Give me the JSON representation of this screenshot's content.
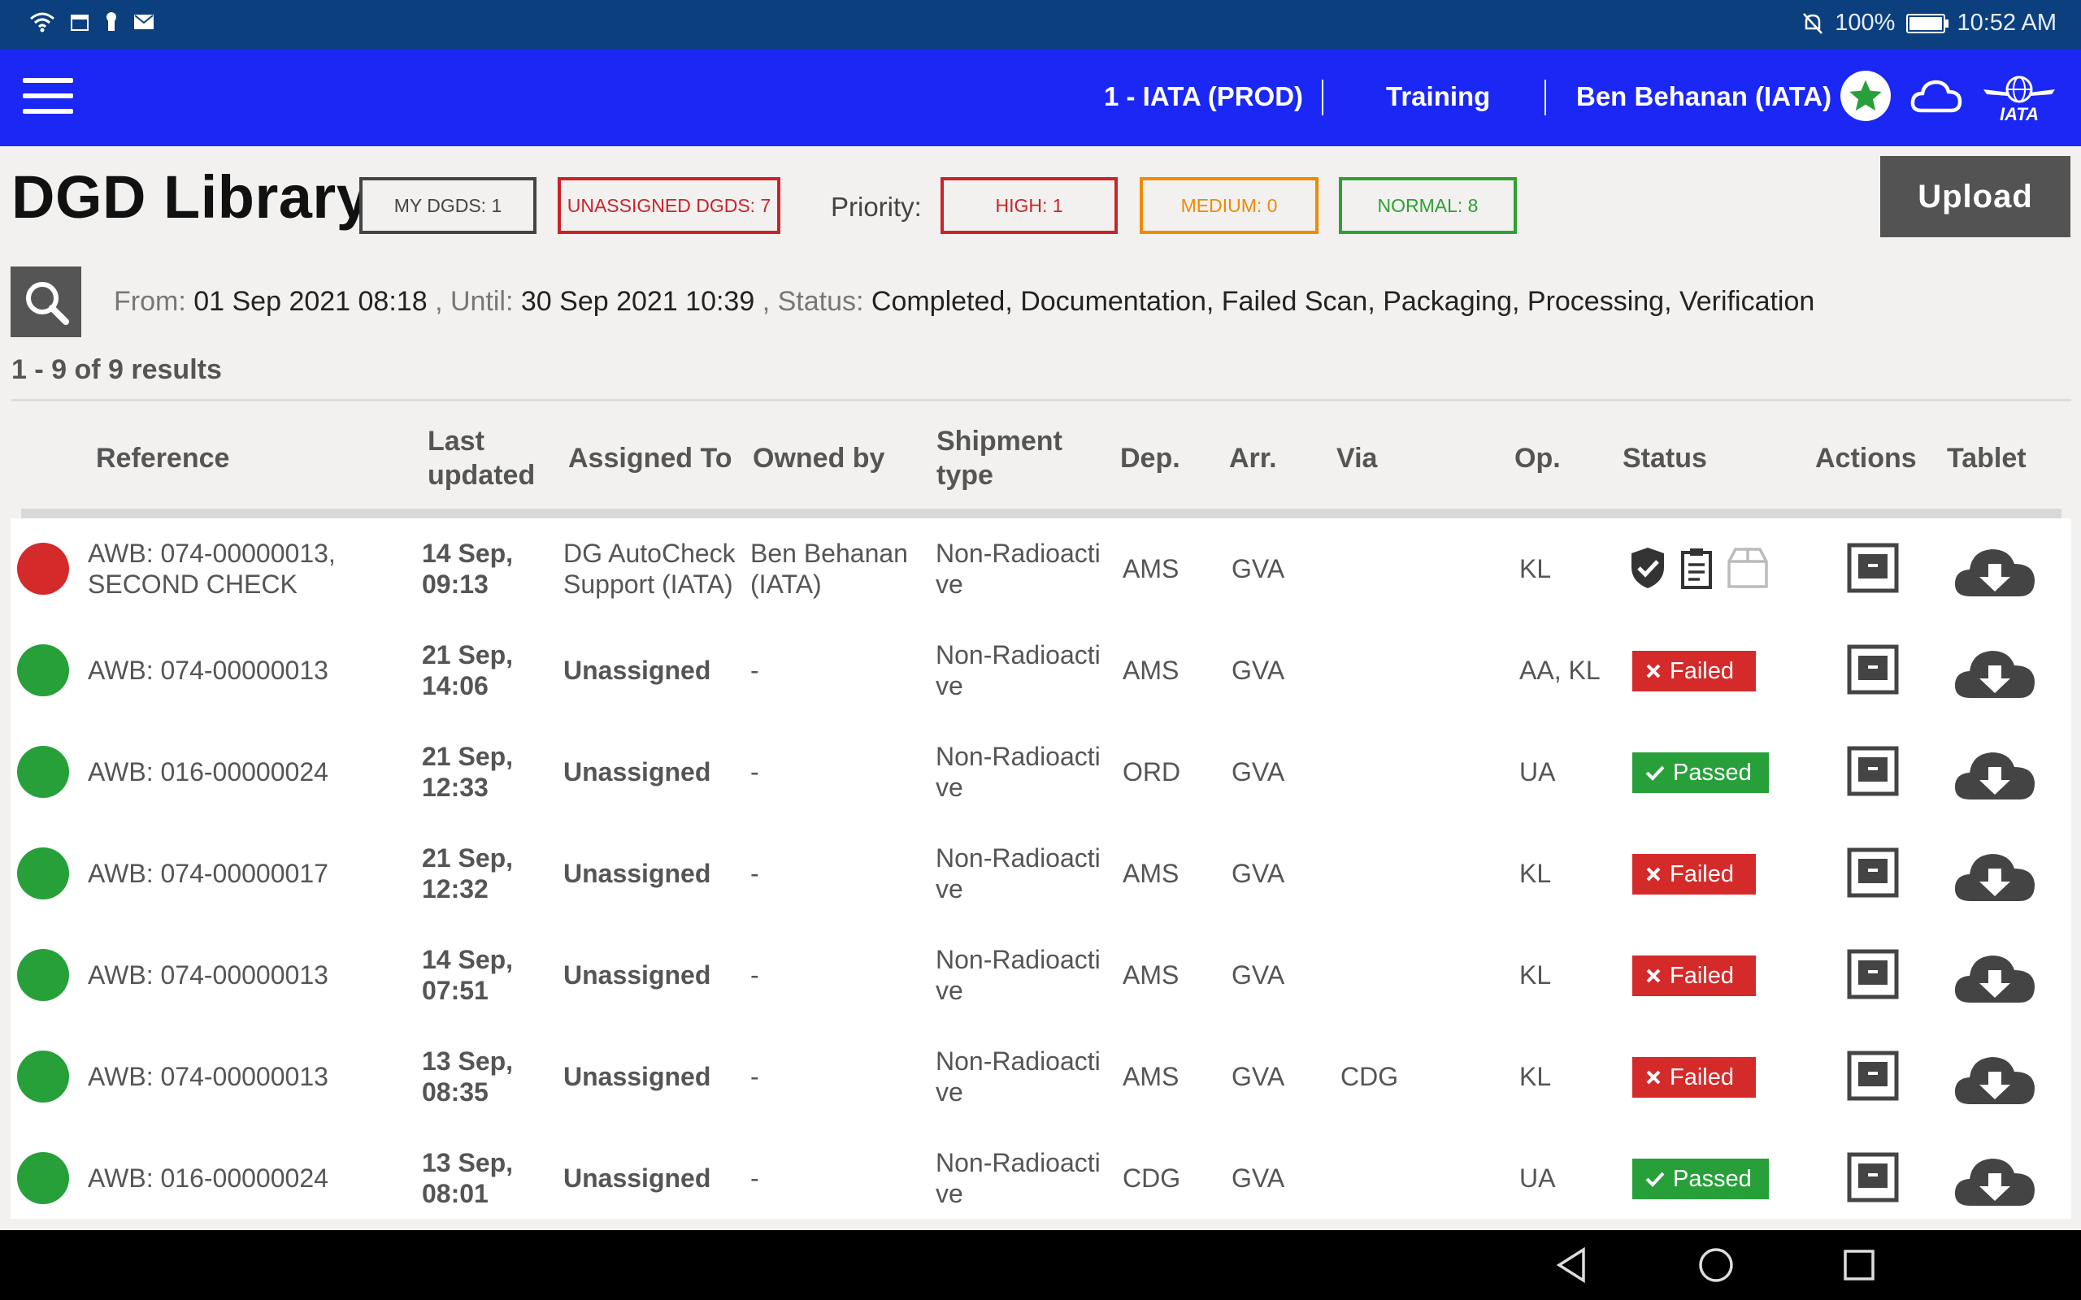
{
  "status_bar": {
    "battery": "100%",
    "time": "10:52 AM"
  },
  "app_bar": {
    "environment": "1 - IATA (PROD)",
    "mode": "Training",
    "user": "Ben Behanan (IATA)",
    "logo_text": "IATA"
  },
  "page": {
    "title": "DGD Library",
    "my_dgds": "MY DGDS: 1",
    "unassigned_dgds": "UNASSIGNED DGDS: 7",
    "priority_label": "Priority:",
    "priority_high": "HIGH: 1",
    "priority_medium": "MEDIUM: 0",
    "priority_normal": "NORMAL: 8",
    "upload": "Upload"
  },
  "filter": {
    "from_label": "From:",
    "from_value": "01 Sep 2021 08:18",
    "until_label": ", Until:",
    "until_value": "30 Sep 2021 10:39",
    "status_label": ", Status:",
    "status_value": "Completed, Documentation, Failed Scan, Packaging, Processing, Verification"
  },
  "results": "1 - 9 of 9 results",
  "table": {
    "headers": {
      "reference": "Reference",
      "last_updated_1": "Last",
      "last_updated_2": "updated",
      "assigned_to": "Assigned To",
      "owned_by": "Owned by",
      "shipment_type_1": "Shipment",
      "shipment_type_2": "type",
      "dep": "Dep.",
      "arr": "Arr.",
      "via": "Via",
      "op": "Op.",
      "status": "Status",
      "actions": "Actions",
      "tablet": "Tablet"
    },
    "rows": [
      {
        "priority_color": "#d42a2a",
        "ref1": "AWB: 074-00000013,",
        "ref2": "SECOND CHECK",
        "upd1": "14 Sep,",
        "upd2": "09:13",
        "assigned1": "DG AutoCheck",
        "assigned2": "Support (IATA)",
        "owned1": "Ben Behanan",
        "owned2": "(IATA)",
        "ship1": "Non-Radioacti",
        "ship2": "ve",
        "dep": "AMS",
        "arr": "GVA",
        "via": "",
        "op": "KL",
        "status": ""
      },
      {
        "priority_color": "#27a03a",
        "ref1": "AWB: 074-00000013",
        "ref2": "",
        "upd1": "21 Sep,",
        "upd2": "14:06",
        "assigned1": "Unassigned",
        "assigned2": "",
        "owned1": "-",
        "owned2": "",
        "ship1": "Non-Radioacti",
        "ship2": "ve",
        "dep": "AMS",
        "arr": "GVA",
        "via": "",
        "op": "AA, KL",
        "status": "Failed"
      },
      {
        "priority_color": "#27a03a",
        "ref1": "AWB: 016-00000024",
        "ref2": "",
        "upd1": "21 Sep,",
        "upd2": "12:33",
        "assigned1": "Unassigned",
        "assigned2": "",
        "owned1": "-",
        "owned2": "",
        "ship1": "Non-Radioacti",
        "ship2": "ve",
        "dep": "ORD",
        "arr": "GVA",
        "via": "",
        "op": "UA",
        "status": "Passed"
      },
      {
        "priority_color": "#27a03a",
        "ref1": "AWB: 074-00000017",
        "ref2": "",
        "upd1": "21 Sep,",
        "upd2": "12:32",
        "assigned1": "Unassigned",
        "assigned2": "",
        "owned1": "-",
        "owned2": "",
        "ship1": "Non-Radioacti",
        "ship2": "ve",
        "dep": "AMS",
        "arr": "GVA",
        "via": "",
        "op": "KL",
        "status": "Failed"
      },
      {
        "priority_color": "#27a03a",
        "ref1": "AWB: 074-00000013",
        "ref2": "",
        "upd1": "14 Sep,",
        "upd2": "07:51",
        "assigned1": "Unassigned",
        "assigned2": "",
        "owned1": "-",
        "owned2": "",
        "ship1": "Non-Radioacti",
        "ship2": "ve",
        "dep": "AMS",
        "arr": "GVA",
        "via": "",
        "op": "KL",
        "status": "Failed"
      },
      {
        "priority_color": "#27a03a",
        "ref1": "AWB: 074-00000013",
        "ref2": "",
        "upd1": "13 Sep,",
        "upd2": "08:35",
        "assigned1": "Unassigned",
        "assigned2": "",
        "owned1": "-",
        "owned2": "",
        "ship1": "Non-Radioacti",
        "ship2": "ve",
        "dep": "AMS",
        "arr": "GVA",
        "via": "CDG",
        "op": "KL",
        "status": "Failed"
      },
      {
        "priority_color": "#27a03a",
        "ref1": "AWB: 016-00000024",
        "ref2": "",
        "upd1": "13 Sep,",
        "upd2": "08:01",
        "assigned1": "Unassigned",
        "assigned2": "",
        "owned1": "-",
        "owned2": "",
        "ship1": "Non-Radioacti",
        "ship2": "ve",
        "dep": "CDG",
        "arr": "GVA",
        "via": "",
        "op": "UA",
        "status": "Passed"
      }
    ]
  },
  "colors": {
    "status_bar": "#0b3f7e",
    "app_bar": "#1a27f5",
    "high": "#cc2229",
    "medium": "#f08a00",
    "normal": "#2ea132",
    "failed": "#d42a2a",
    "passed": "#27a03a"
  },
  "icons": {
    "menu": "hamburger-icon",
    "favorite": "star-icon",
    "sync": "cloud-icon",
    "search": "search-icon",
    "archive": "archive-icon",
    "download": "cloud-download-icon",
    "nav_back": "back-triangle-icon",
    "nav_home": "home-circle-icon",
    "nav_recents": "recents-square-icon"
  }
}
